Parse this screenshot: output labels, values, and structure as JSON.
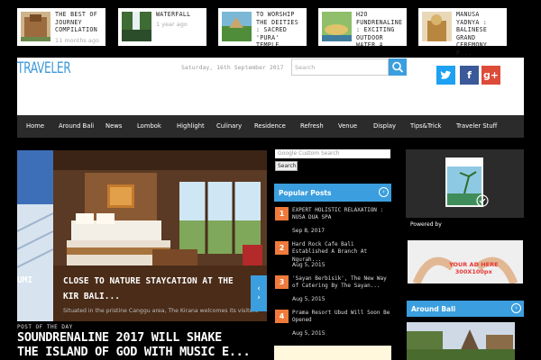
{
  "recent_posts": [
    {
      "title": "THE BEST OF JOURNEY COMPILATION",
      "meta": "11 months ago"
    },
    {
      "title": "WATERFALL",
      "meta": "1 year ago"
    },
    {
      "title": "TO WORSHIP THE DEITIES : SACRED 'PURA' TEMPLE...",
      "meta": ""
    },
    {
      "title": "H2O FUNDRENALINE : EXCITING OUTDOOR WATER A...",
      "meta": ""
    },
    {
      "title": "MANUSA YADNYA : BALINESE GRAND CEREMONY F...",
      "meta": ""
    }
  ],
  "header": {
    "logo": "TRAVELER",
    "date": "Saturday, 16th September 2017",
    "search_placeholder": "Search",
    "social": {
      "twitter": "t",
      "facebook": "f",
      "google": "g+"
    },
    "colors": {
      "twitter": "#1da1f2",
      "facebook": "#3b5998",
      "google": "#dd4b39",
      "accent": "#3b9ede"
    }
  },
  "nav": [
    "Home",
    "Around Bali",
    "News",
    "Lombok",
    "Highlight",
    "Culinary",
    "Residence",
    "Refresh",
    "Venue",
    "Display",
    "Tips&Trick",
    "Traveler Stuff"
  ],
  "slider": {
    "left_title": "UMI",
    "title": "CLOSE TO NATURE STAYCATION AT THE KIR BALI...",
    "excerpt": "Situated in the pristine Canggu area, The Kirana welcomes its visitors w",
    "arrow": "‹"
  },
  "post_of_day": {
    "label": "POST OF THE DAY",
    "title_line1": "SOUNDRENALINE 2017 WILL SHAKE",
    "title_line2": "THE ISLAND OF GOD WITH MUSIC E..."
  },
  "search_widget": {
    "placeholder": "Google Custom Search",
    "button": "Search"
  },
  "popular_posts": {
    "heading": "Popular Posts",
    "icon": "›",
    "items": [
      {
        "num": "1",
        "title": "EXPERT HOLISTIC RELAXATION : NUSA DUA SPA",
        "date": "Sep 8, 2017"
      },
      {
        "num": "2",
        "title": "Hard Rock Cafe Bali Established A Branch At Ngurah...",
        "date": "Aug 5, 2015"
      },
      {
        "num": "3",
        "title": "'Sayan Berbisik', The New Way of Catering By The Sayan...",
        "date": "Aug 5, 2015"
      },
      {
        "num": "4",
        "title": "Prama Resort Ubud Will Soon Be Opened",
        "date": "Aug 5, 2015"
      }
    ]
  },
  "sidebar": {
    "powered_by": "Powered by",
    "ad_text": "YOUR AD HERE",
    "ad_size": "300X100px",
    "around_bali": "Around Bali",
    "around_icon": "›"
  }
}
